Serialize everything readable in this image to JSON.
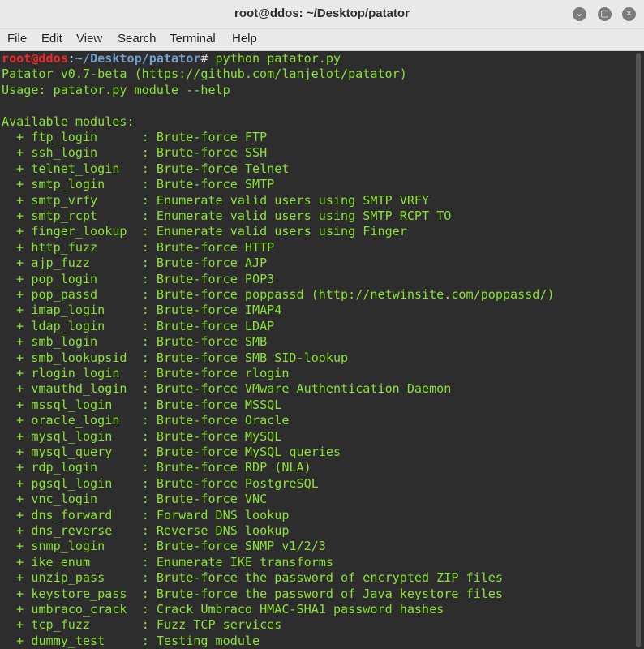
{
  "window": {
    "title": "root@ddos: ~/Desktop/patator",
    "controls": {
      "minimize": "⌄",
      "maximize": "▢",
      "close": "×"
    }
  },
  "menu": [
    "File",
    "Edit",
    "View",
    "Search",
    "Terminal",
    "Help"
  ],
  "terminal": {
    "prompt": {
      "user_host": "root@ddos",
      "sep": ":",
      "path": "~/Desktop/patator",
      "symbol": "#",
      "command": " python patator.py"
    },
    "header_lines": [
      "Patator v0.7-beta (https://github.com/lanjelot/patator)",
      "Usage: patator.py module --help",
      "",
      "Available modules:"
    ],
    "modules": [
      {
        "name": "ftp_login",
        "desc": "Brute-force FTP"
      },
      {
        "name": "ssh_login",
        "desc": "Brute-force SSH"
      },
      {
        "name": "telnet_login",
        "desc": "Brute-force Telnet"
      },
      {
        "name": "smtp_login",
        "desc": "Brute-force SMTP"
      },
      {
        "name": "smtp_vrfy",
        "desc": "Enumerate valid users using SMTP VRFY"
      },
      {
        "name": "smtp_rcpt",
        "desc": "Enumerate valid users using SMTP RCPT TO"
      },
      {
        "name": "finger_lookup",
        "desc": "Enumerate valid users using Finger"
      },
      {
        "name": "http_fuzz",
        "desc": "Brute-force HTTP"
      },
      {
        "name": "ajp_fuzz",
        "desc": "Brute-force AJP"
      },
      {
        "name": "pop_login",
        "desc": "Brute-force POP3"
      },
      {
        "name": "pop_passd",
        "desc": "Brute-force poppassd (http://netwinsite.com/poppassd/)"
      },
      {
        "name": "imap_login",
        "desc": "Brute-force IMAP4"
      },
      {
        "name": "ldap_login",
        "desc": "Brute-force LDAP"
      },
      {
        "name": "smb_login",
        "desc": "Brute-force SMB"
      },
      {
        "name": "smb_lookupsid",
        "desc": "Brute-force SMB SID-lookup"
      },
      {
        "name": "rlogin_login",
        "desc": "Brute-force rlogin"
      },
      {
        "name": "vmauthd_login",
        "desc": "Brute-force VMware Authentication Daemon"
      },
      {
        "name": "mssql_login",
        "desc": "Brute-force MSSQL"
      },
      {
        "name": "oracle_login",
        "desc": "Brute-force Oracle"
      },
      {
        "name": "mysql_login",
        "desc": "Brute-force MySQL"
      },
      {
        "name": "mysql_query",
        "desc": "Brute-force MySQL queries"
      },
      {
        "name": "rdp_login",
        "desc": "Brute-force RDP (NLA)"
      },
      {
        "name": "pgsql_login",
        "desc": "Brute-force PostgreSQL"
      },
      {
        "name": "vnc_login",
        "desc": "Brute-force VNC"
      },
      {
        "name": "dns_forward",
        "desc": "Forward DNS lookup"
      },
      {
        "name": "dns_reverse",
        "desc": "Reverse DNS lookup"
      },
      {
        "name": "snmp_login",
        "desc": "Brute-force SNMP v1/2/3"
      },
      {
        "name": "ike_enum",
        "desc": "Enumerate IKE transforms"
      },
      {
        "name": "unzip_pass",
        "desc": "Brute-force the password of encrypted ZIP files"
      },
      {
        "name": "keystore_pass",
        "desc": "Brute-force the password of Java keystore files"
      },
      {
        "name": "umbraco_crack",
        "desc": "Crack Umbraco HMAC-SHA1 password hashes"
      },
      {
        "name": "tcp_fuzz",
        "desc": "Fuzz TCP services"
      },
      {
        "name": "dummy_test",
        "desc": "Testing module"
      }
    ]
  },
  "colors": {
    "terminal_bg": "#2d2d2d",
    "text_green": "#8ae234",
    "prompt_red": "#ef2929",
    "prompt_blue": "#729fcf"
  }
}
